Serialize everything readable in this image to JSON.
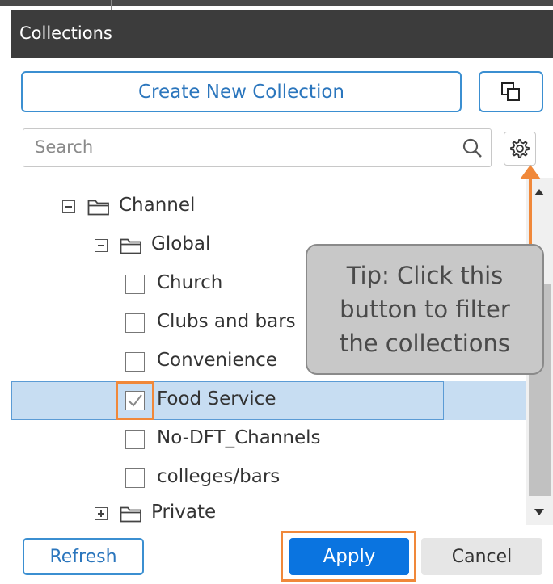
{
  "panel": {
    "title": "Collections",
    "create_button_label": "Create New Collection",
    "copy_icon": "copy-icon"
  },
  "search": {
    "placeholder": "Search",
    "search_icon": "magnifier-icon",
    "settings_icon": "gear-icon"
  },
  "tree": [
    {
      "label": "Channel",
      "level": 0,
      "kind": "folder",
      "expanded": true
    },
    {
      "label": "Global",
      "level": 1,
      "kind": "folder",
      "expanded": true
    },
    {
      "label": "Church",
      "level": 2,
      "kind": "checkbox",
      "checked": false
    },
    {
      "label": "Clubs and bars",
      "level": 2,
      "kind": "checkbox",
      "checked": false
    },
    {
      "label": "Convenience",
      "level": 2,
      "kind": "checkbox",
      "checked": false
    },
    {
      "label": "Food Service",
      "level": 2,
      "kind": "checkbox",
      "checked": true,
      "selected": true
    },
    {
      "label": "No-DFT_Channels",
      "level": 2,
      "kind": "checkbox",
      "checked": false
    },
    {
      "label": "colleges/bars",
      "level": 2,
      "kind": "checkbox",
      "checked": false
    },
    {
      "label": "Private",
      "level": 1,
      "kind": "folder",
      "expanded": false
    }
  ],
  "tip": {
    "text": "Tip: Click this\nbutton to filter\nthe collections"
  },
  "footer": {
    "refresh_label": "Refresh",
    "apply_label": "Apply",
    "cancel_label": "Cancel"
  },
  "colors": {
    "accent_blue": "#0a74e0",
    "highlight_orange": "#f0883a",
    "selected_row": "#c7ddf2",
    "header_bg": "#3c3c3c"
  }
}
